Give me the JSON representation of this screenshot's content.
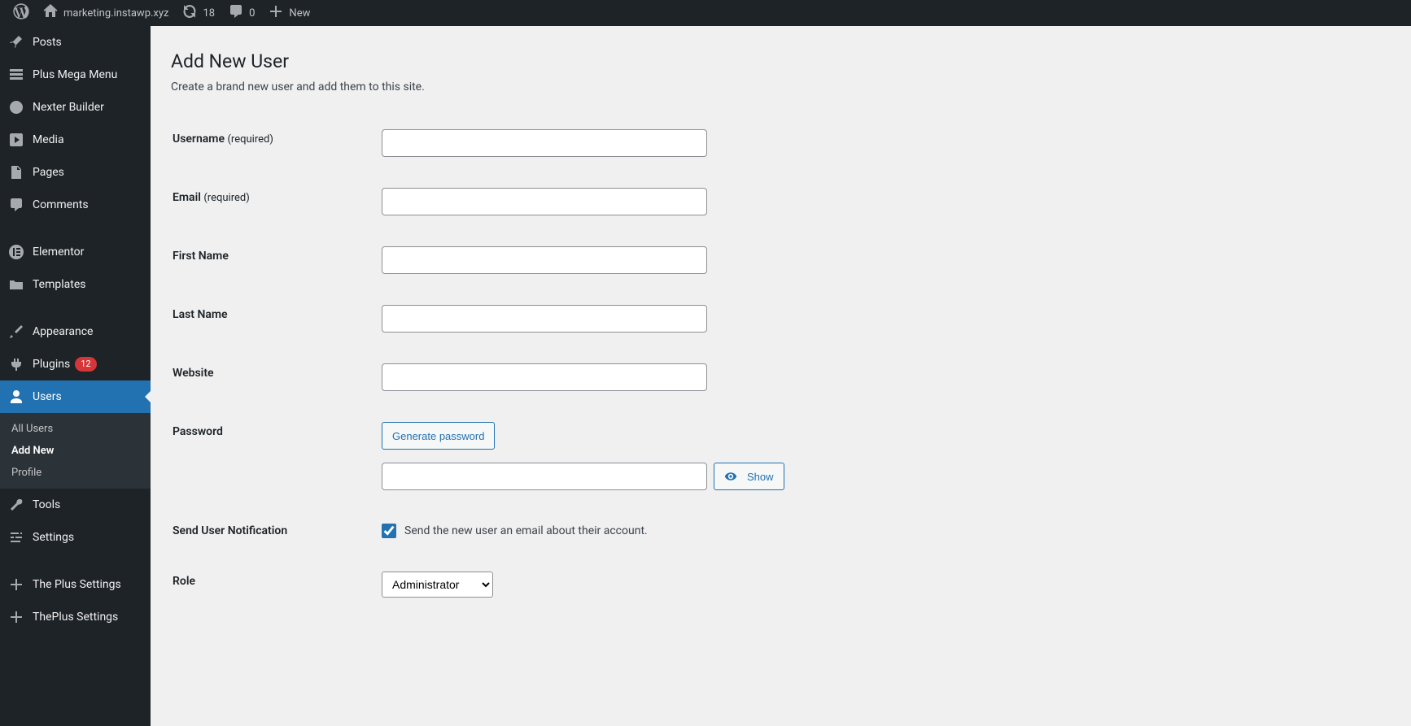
{
  "adminbar": {
    "site_name": "marketing.instawp.xyz",
    "updates_count": "18",
    "comments_count": "0",
    "new_label": "New"
  },
  "sidebar": {
    "items": [
      {
        "id": "posts",
        "label": "Posts"
      },
      {
        "id": "plus-mega-menu",
        "label": "Plus Mega Menu"
      },
      {
        "id": "nexter-builder",
        "label": "Nexter Builder"
      },
      {
        "id": "media",
        "label": "Media"
      },
      {
        "id": "pages",
        "label": "Pages"
      },
      {
        "id": "comments",
        "label": "Comments"
      },
      {
        "id": "elementor",
        "label": "Elementor"
      },
      {
        "id": "templates",
        "label": "Templates"
      },
      {
        "id": "appearance",
        "label": "Appearance"
      },
      {
        "id": "plugins",
        "label": "Plugins",
        "badge": "12"
      },
      {
        "id": "users",
        "label": "Users",
        "active": true
      },
      {
        "id": "tools",
        "label": "Tools"
      },
      {
        "id": "settings",
        "label": "Settings"
      },
      {
        "id": "the-plus-settings",
        "label": "The Plus Settings"
      },
      {
        "id": "theplus-settings",
        "label": "ThePlus Settings"
      }
    ],
    "users_submenu": [
      {
        "id": "all-users",
        "label": "All Users"
      },
      {
        "id": "add-new",
        "label": "Add New",
        "current": true
      },
      {
        "id": "profile",
        "label": "Profile"
      }
    ]
  },
  "page": {
    "title": "Add New User",
    "subtitle": "Create a brand new user and add them to this site.",
    "labels": {
      "username": "Username",
      "email": "Email",
      "first_name": "First Name",
      "last_name": "Last Name",
      "website": "Website",
      "password": "Password",
      "send_notification": "Send User Notification",
      "role": "Role",
      "required": "(required)"
    },
    "buttons": {
      "generate_password": "Generate password",
      "show": "Show"
    },
    "notification_text": "Send the new user an email about their account.",
    "notification_checked": true,
    "role_selected": "Administrator"
  }
}
